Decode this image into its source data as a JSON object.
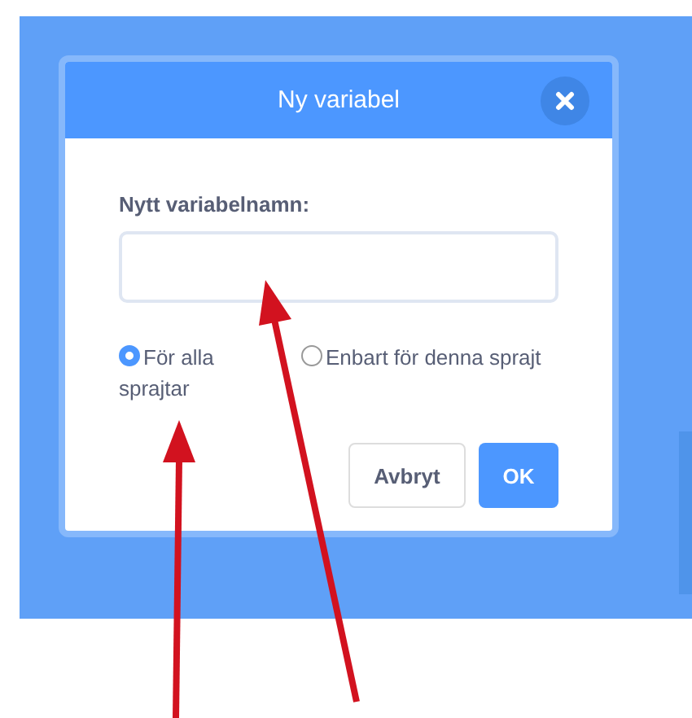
{
  "dialog": {
    "title": "Ny variabel",
    "field_label": "Nytt variabelnamn:",
    "scope_options": [
      {
        "label": "För alla sprajtar",
        "selected": true
      },
      {
        "label": "Enbart för denna sprajt",
        "selected": false
      }
    ],
    "buttons": [
      {
        "label": "Avbryt",
        "kind": "secondary"
      },
      {
        "label": "OK",
        "kind": "primary"
      }
    ]
  }
}
